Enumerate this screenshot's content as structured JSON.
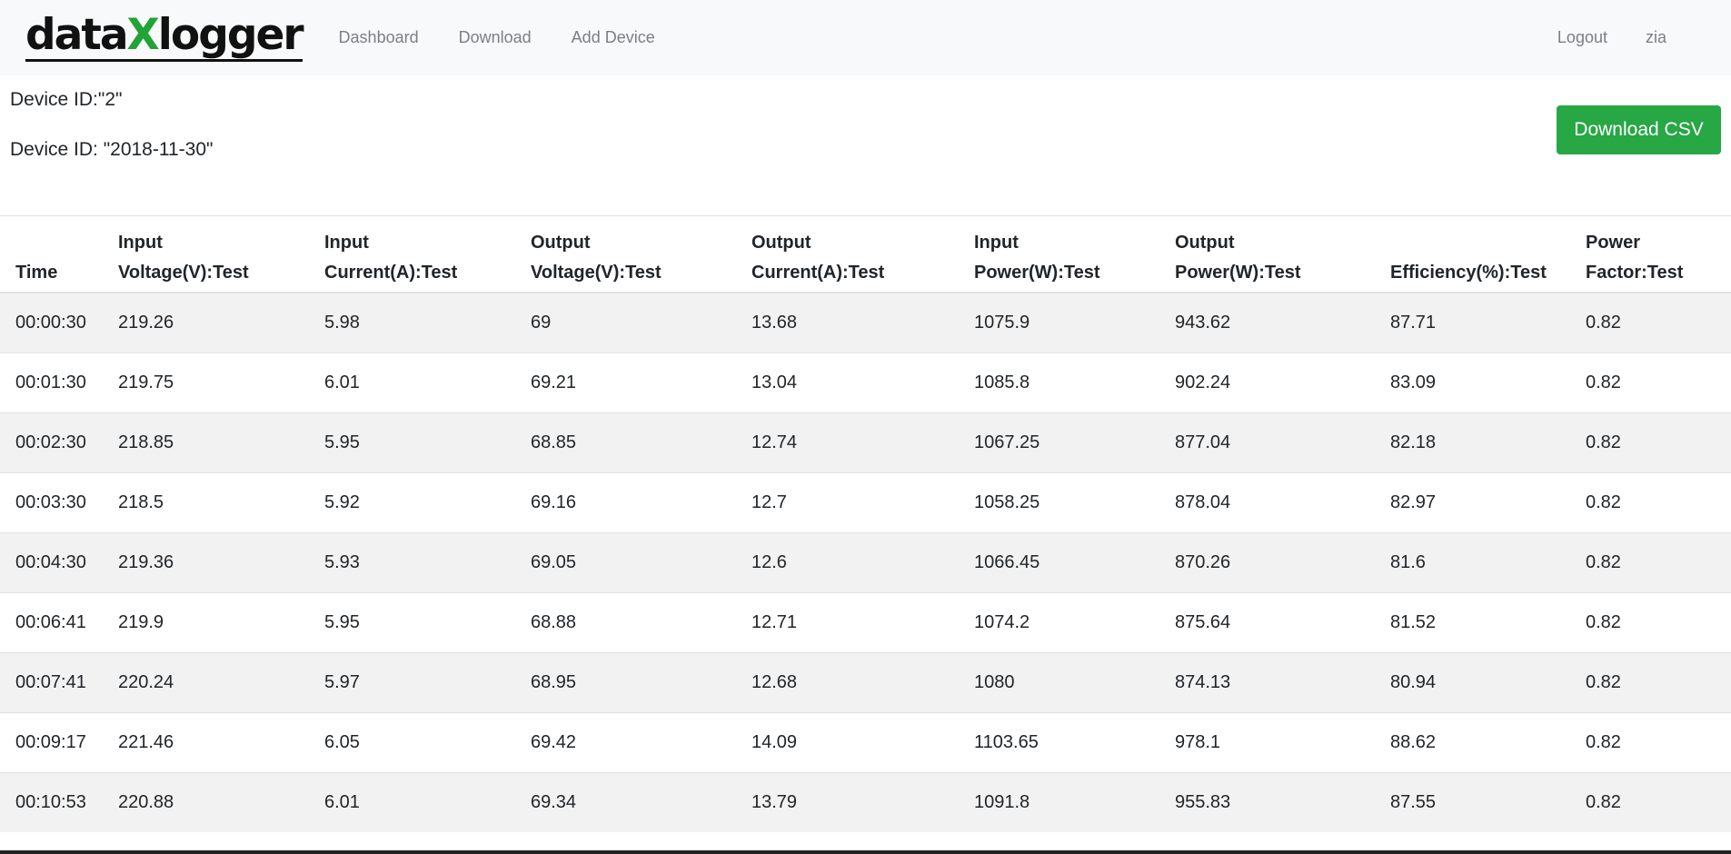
{
  "brand": {
    "part1": "data",
    "part2": "X",
    "part3": "logger",
    "accent": "#21a336"
  },
  "nav": {
    "dashboard": "Dashboard",
    "download": "Download",
    "add_device": "Add Device",
    "logout": "Logout",
    "user": "zia"
  },
  "info": {
    "device_id": "Device ID:\"2\"",
    "date_line": "Device ID: \"2018-11-30\""
  },
  "download_button": {
    "label": "Download CSV",
    "color": "#28a745"
  },
  "table": {
    "headers": [
      [
        "Time"
      ],
      [
        "Input",
        "Voltage(V):Test"
      ],
      [
        "Input",
        "Current(A):Test"
      ],
      [
        "Output",
        "Voltage(V):Test"
      ],
      [
        "Output",
        "Current(A):Test"
      ],
      [
        "Input",
        "Power(W):Test"
      ],
      [
        "Output",
        "Power(W):Test"
      ],
      [
        "Efficiency(%):Test"
      ],
      [
        "Power",
        "Factor:Test"
      ]
    ],
    "rows": [
      [
        "00:00:30",
        "219.26",
        "5.98",
        "69",
        "13.68",
        "1075.9",
        "943.62",
        "87.71",
        "0.82"
      ],
      [
        "00:01:30",
        "219.75",
        "6.01",
        "69.21",
        "13.04",
        "1085.8",
        "902.24",
        "83.09",
        "0.82"
      ],
      [
        "00:02:30",
        "218.85",
        "5.95",
        "68.85",
        "12.74",
        "1067.25",
        "877.04",
        "82.18",
        "0.82"
      ],
      [
        "00:03:30",
        "218.5",
        "5.92",
        "69.16",
        "12.7",
        "1058.25",
        "878.04",
        "82.97",
        "0.82"
      ],
      [
        "00:04:30",
        "219.36",
        "5.93",
        "69.05",
        "12.6",
        "1066.45",
        "870.26",
        "81.6",
        "0.82"
      ],
      [
        "00:06:41",
        "219.9",
        "5.95",
        "68.88",
        "12.71",
        "1074.2",
        "875.64",
        "81.52",
        "0.82"
      ],
      [
        "00:07:41",
        "220.24",
        "5.97",
        "68.95",
        "12.68",
        "1080",
        "874.13",
        "80.94",
        "0.82"
      ],
      [
        "00:09:17",
        "221.46",
        "6.05",
        "69.42",
        "14.09",
        "1103.65",
        "978.1",
        "88.62",
        "0.82"
      ],
      [
        "00:10:53",
        "220.88",
        "6.01",
        "69.34",
        "13.79",
        "1091.8",
        "955.83",
        "87.55",
        "0.82"
      ]
    ]
  }
}
